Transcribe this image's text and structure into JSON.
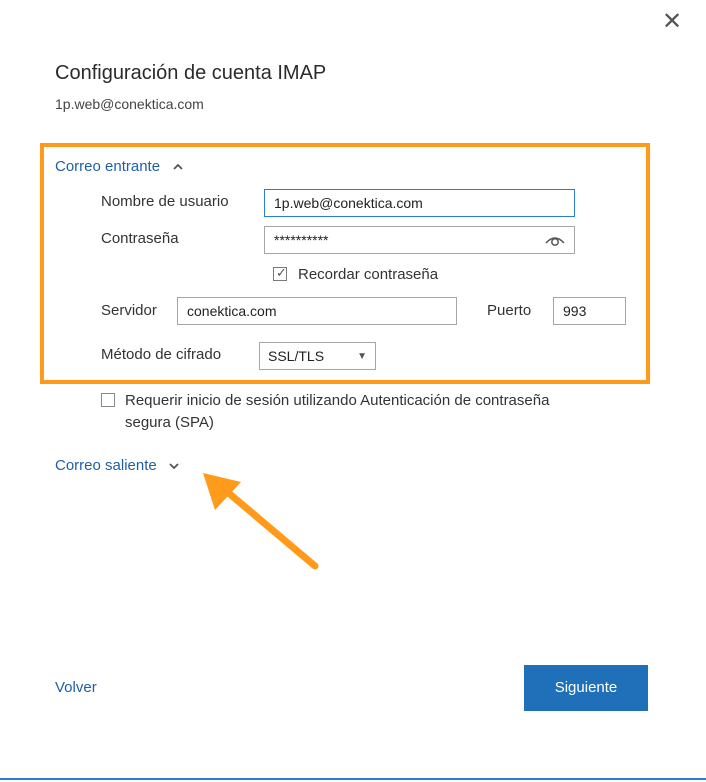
{
  "dialog": {
    "close_symbol": "✕",
    "title": "Configuración de cuenta IMAP",
    "account_email": "1p.web@conektica.com"
  },
  "incoming": {
    "section_label": "Correo entrante",
    "expanded": true,
    "username_label": "Nombre de usuario",
    "username_value": "1p.web@conektica.com",
    "password_label": "Contraseña",
    "password_value": "**********",
    "remember_password_label": "Recordar contraseña",
    "remember_password_checked": true,
    "server_label": "Servidor",
    "server_value": "conektica.com",
    "port_label": "Puerto",
    "port_value": "993",
    "encryption_label": "Método de cifrado",
    "encryption_value": "SSL/TLS"
  },
  "spa": {
    "label_line1": "Requerir inicio de sesión utilizando Autenticación de contraseña",
    "label_line2": "segura (SPA)",
    "checked": false
  },
  "outgoing": {
    "section_label": "Correo saliente",
    "expanded": false
  },
  "footer": {
    "back_label": "Volver",
    "next_label": "Siguiente"
  },
  "colors": {
    "accent": "#1f6fb9",
    "link": "#1f5fa8",
    "highlight": "#ff9a1a"
  },
  "icons": {
    "close": "close-icon",
    "collapse": "chevron-up-icon",
    "expand": "chevron-down-icon",
    "show_password": "eye-icon",
    "dropdown": "dropdown-arrow-icon",
    "annotation": "arrow-annotation"
  }
}
